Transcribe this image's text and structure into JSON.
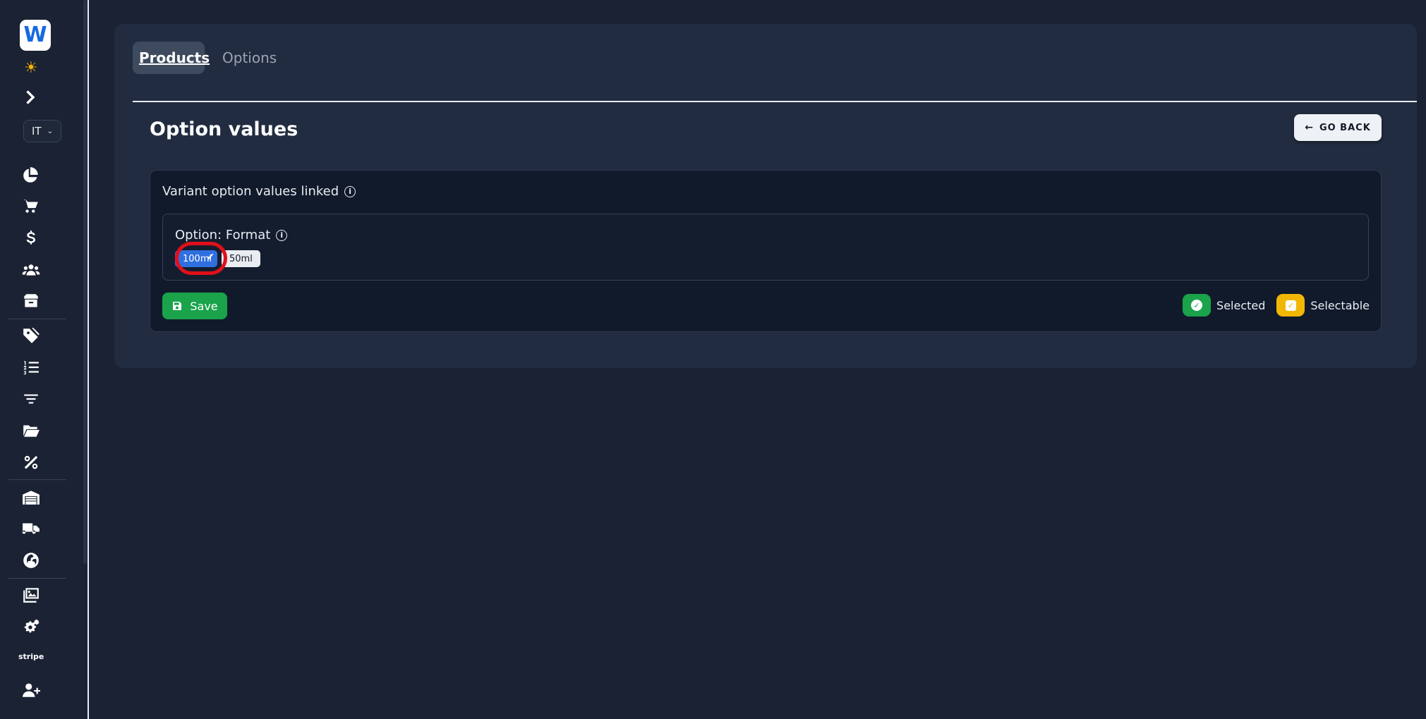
{
  "sidebar": {
    "logo_letter": "W",
    "language": "IT",
    "items": [
      {
        "name": "dashboard-icon"
      },
      {
        "name": "cart-icon"
      },
      {
        "name": "dollar-icon"
      },
      {
        "name": "users-icon"
      },
      {
        "name": "box-icon"
      },
      {
        "name": "tags-icon"
      },
      {
        "name": "ordered-list-icon"
      },
      {
        "name": "filter-icon"
      },
      {
        "name": "folder-icon"
      },
      {
        "name": "percent-icon"
      },
      {
        "name": "warehouse-icon"
      },
      {
        "name": "truck-icon"
      },
      {
        "name": "globe-icon"
      },
      {
        "name": "images-icon"
      },
      {
        "name": "gears-icon"
      },
      {
        "name": "user-plus-icon"
      }
    ],
    "stripe_label": "stripe"
  },
  "tabs": {
    "products": "Products",
    "options": "Options"
  },
  "page": {
    "title": "Option values",
    "go_back": "GO BACK"
  },
  "panel": {
    "title": "Variant option values linked",
    "option_label": "Option: Format",
    "chips": [
      {
        "label": "100ml",
        "state": "selected"
      },
      {
        "label": "50ml",
        "state": "unselected"
      }
    ],
    "save_label": "Save",
    "legend": {
      "selected": "Selected",
      "selectable": "Selectable"
    }
  },
  "colors": {
    "background": "#1a2233",
    "card": "#212c40",
    "panel": "#111a2b",
    "selected_chip": "#2f6fe0",
    "save_green": "#1aa34a",
    "selectable_yellow": "#f2b705",
    "highlight_red": "#e0101a"
  }
}
